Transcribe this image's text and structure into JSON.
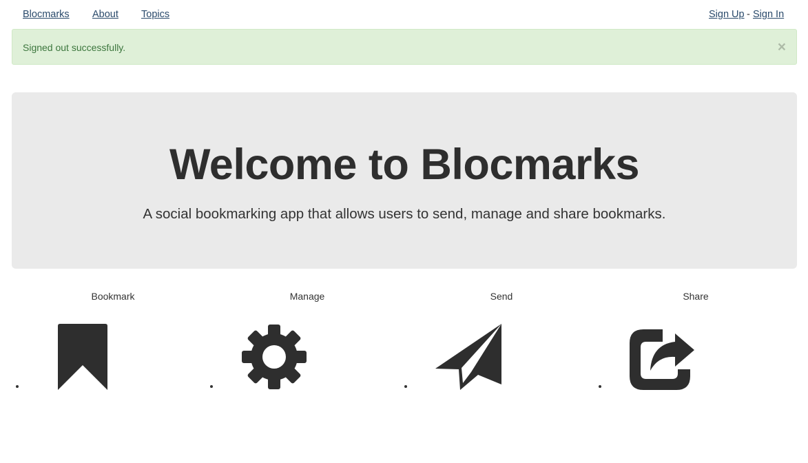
{
  "nav": {
    "brand": "Blocmarks",
    "about": "About",
    "topics": "Topics",
    "sign_up": "Sign Up",
    "separator": "-",
    "sign_in": "Sign In"
  },
  "alert": {
    "message": "Signed out successfully.",
    "close_symbol": "×"
  },
  "hero": {
    "title": "Welcome to Blocmarks",
    "subtitle": "A social bookmarking app that allows users to send, manage and share bookmarks."
  },
  "features": [
    {
      "label": "Bookmark",
      "icon": "bookmark-icon"
    },
    {
      "label": "Manage",
      "icon": "gear-icon"
    },
    {
      "label": "Send",
      "icon": "paper-plane-icon"
    },
    {
      "label": "Share",
      "icon": "share-icon"
    }
  ],
  "colors": {
    "link": "#2a4a6b",
    "alert_bg": "#dff0d8",
    "alert_text": "#3c763d",
    "hero_bg": "#eaeaea",
    "icon": "#2e2e2e"
  }
}
